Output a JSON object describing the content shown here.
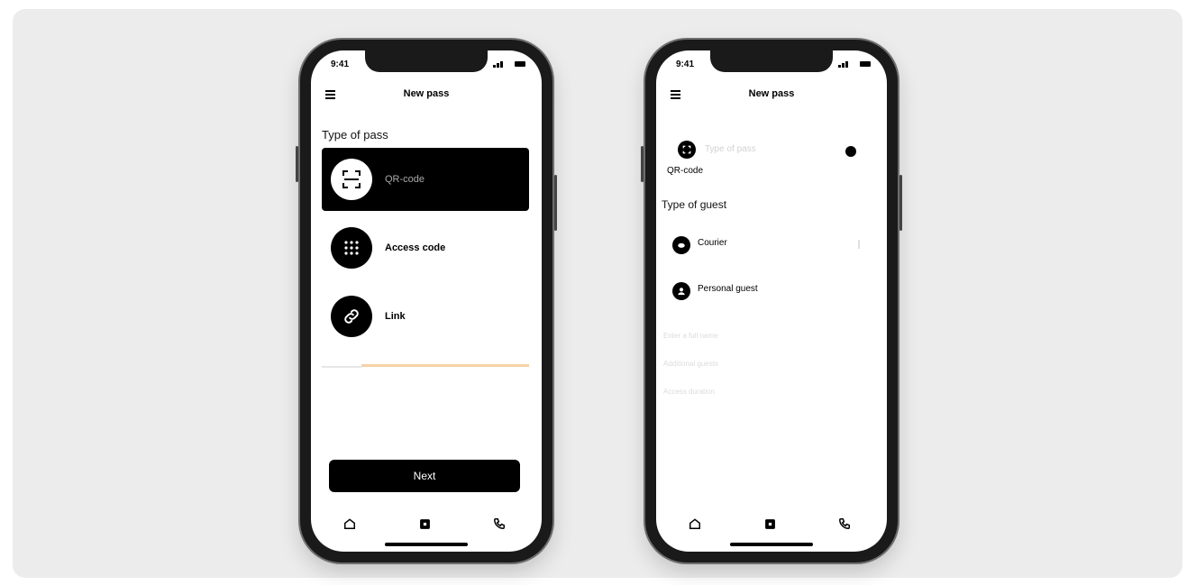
{
  "status": {
    "time": "9:41"
  },
  "screen1": {
    "title": "New pass",
    "section_label": "Type of pass",
    "options": [
      {
        "label": "QR-code",
        "icon": "qr-scan-icon",
        "selected": true
      },
      {
        "label": "Access code",
        "icon": "keypad-icon",
        "selected": false
      },
      {
        "label": "Link",
        "icon": "link-icon",
        "selected": false
      }
    ],
    "next_label": "Next"
  },
  "screen2": {
    "title": "New pass",
    "pass_type_caption": "Type of pass",
    "pass_type_value": "QR-code",
    "section_label": "Type of guest",
    "guest_types": [
      {
        "label": "Courier",
        "icon": "courier-icon"
      },
      {
        "label": "Personal guest",
        "icon": "person-icon"
      }
    ],
    "form_fields": [
      "Enter a full name",
      "Additional guests",
      "Access duration"
    ]
  },
  "nav": {
    "items": [
      "home-icon",
      "pass-icon",
      "phone-icon"
    ]
  },
  "colors": {
    "accent": "#f5d2a8",
    "primary": "#000000",
    "background": "#ececec"
  }
}
